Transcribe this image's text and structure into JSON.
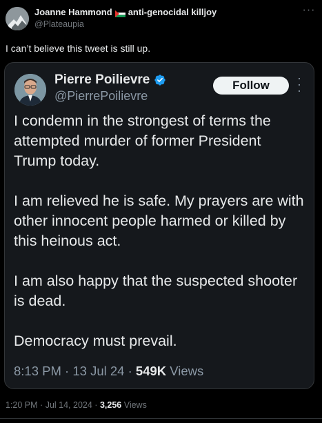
{
  "tweet": {
    "author_name": "Joanne Hammond",
    "author_suffix": "anti-genocidal killjoy",
    "handle": "@Plateaupia",
    "text": "I can’t believe this tweet is still up.",
    "time": "1:20 PM",
    "date": "Jul 14, 2024",
    "views_count": "3,256",
    "views_label": "Views",
    "flag_icon": "palestine-flag-icon"
  },
  "quoted_tweet": {
    "author_name": "Pierre Poilievre",
    "handle": "@PierrePoilievre",
    "follow_label": "Follow",
    "paragraphs": [
      "I condemn in the strongest of terms the attempted murder of former President Trump today.",
      "I am relieved he is safe. My prayers are with other innocent people harmed or killed by this heinous act.",
      "I am also happy that the suspected shooter is dead.",
      "Democracy must prevail."
    ],
    "time": "8:13 PM",
    "date": "13 Jul 24",
    "views_count": "549K",
    "views_label": "Views"
  },
  "separator": "·",
  "colors": {
    "background": "#000000",
    "card_background": "#15181c",
    "text_primary": "#e7e9ea",
    "text_secondary": "#71767b",
    "verified_blue": "#1d9bf0",
    "follow_bg": "#eff3f4"
  }
}
